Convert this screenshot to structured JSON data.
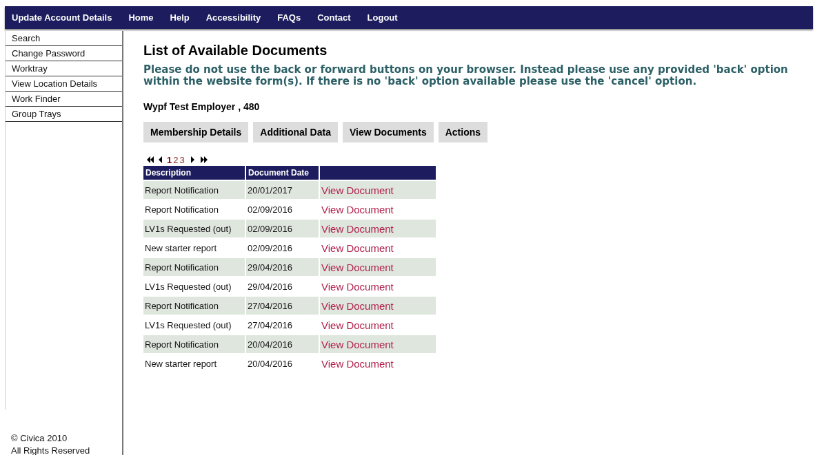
{
  "top_nav": [
    {
      "label": "Update Account Details"
    },
    {
      "label": "Home"
    },
    {
      "label": "Help"
    },
    {
      "label": "Accessibility"
    },
    {
      "label": "FAQs"
    },
    {
      "label": "Contact"
    },
    {
      "label": "Logout"
    }
  ],
  "sidebar": {
    "items": [
      "Search",
      "Change Password",
      "Worktray",
      "View Location Details",
      "Work Finder",
      "Group Trays"
    ],
    "footer": [
      "© Civica 2010",
      "All Rights Reserved"
    ]
  },
  "page_title": "List of Available Documents",
  "warning": "Please do not use the back or forward buttons on your browser. Instead please use any provided 'back' option within the website form(s). If there is no 'back' option available please use the 'cancel' option.",
  "employer": "Wypf Test Employer , 480",
  "tabs": [
    {
      "label": "Membership Details"
    },
    {
      "label": "Additional Data"
    },
    {
      "label": "View Documents"
    },
    {
      "label": "Actions"
    }
  ],
  "pager": {
    "pages": [
      {
        "label": "1",
        "selected": true
      },
      {
        "label": "2",
        "selected": false
      },
      {
        "label": "3",
        "selected": false
      }
    ]
  },
  "table": {
    "columns": [
      "Description",
      "Document Date"
    ],
    "rows": [
      {
        "description": "Report Notification",
        "date": "20/01/2017",
        "link": "View Document"
      },
      {
        "description": "Report Notification",
        "date": "02/09/2016",
        "link": "View Document"
      },
      {
        "description": "LV1s Requested (out)",
        "date": "02/09/2016",
        "link": "View Document"
      },
      {
        "description": "New starter report",
        "date": "02/09/2016",
        "link": "View Document"
      },
      {
        "description": "Report Notification",
        "date": "29/04/2016",
        "link": "View Document"
      },
      {
        "description": "LV1s Requested (out)",
        "date": "29/04/2016",
        "link": "View Document"
      },
      {
        "description": "Report Notification",
        "date": "27/04/2016",
        "link": "View Document"
      },
      {
        "description": "LV1s Requested (out)",
        "date": "27/04/2016",
        "link": "View Document"
      },
      {
        "description": "Report Notification",
        "date": "20/04/2016",
        "link": "View Document"
      },
      {
        "description": "New starter report",
        "date": "20/04/2016",
        "link": "View Document"
      }
    ]
  }
}
